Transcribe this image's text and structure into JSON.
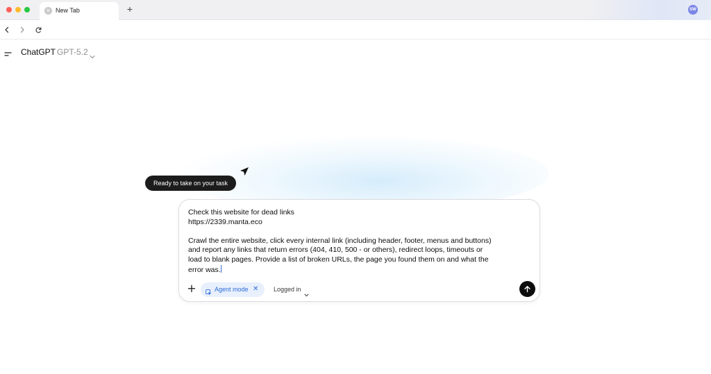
{
  "browser": {
    "tab_title": "New Tab",
    "profile_initials": "SW",
    "icons": [
      "close-icon",
      "plus-icon",
      "back-icon",
      "forward-icon",
      "reload-icon"
    ]
  },
  "app": {
    "title": "ChatGPT",
    "model": "GPT-5.2",
    "tooltip": "Ready to take on your task"
  },
  "composer": {
    "prompt_lines": [
      "Check this website for dead links",
      "https://2339.manta.eco",
      "",
      "Crawl the entire website, click every internal link (including header, footer, menus and buttons)",
      "and report any links that return errors (404, 410, 500 - or others), redirect loops, timeouts or",
      "load to blank pages. Provide a list of broken URLs, the page you found them on and what the",
      "error was."
    ],
    "agent_mode_label": "Agent mode",
    "agent_close": "✕",
    "login_status": "Logged in"
  },
  "colors": {
    "accent": "#2d6bd8",
    "chip_bg": "#e8f0fd",
    "send_button": "#0d0d0d",
    "tooltip_bg": "#1c1c1c"
  }
}
